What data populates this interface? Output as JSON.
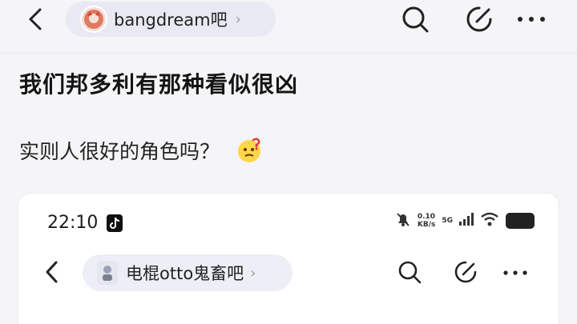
{
  "header": {
    "forum_name": "bangdream吧",
    "chevron": "›",
    "icons": [
      "back-icon",
      "search-icon",
      "edit-icon",
      "more-icon"
    ]
  },
  "post": {
    "title": "我们邦多利有那种看似很凶",
    "body": "实则人很好的角色吗？",
    "emoji": "thinking-face-icon"
  },
  "screenshot": {
    "time": "22:10",
    "net_speed_value": "0.10",
    "net_speed_unit": "KB/s",
    "network": "5G",
    "forum_name": "电棍otto鬼畜吧",
    "chevron": "›"
  },
  "colors": {
    "background": "#f5f5f7",
    "chip": "#e9e9f4",
    "card": "#ffffff",
    "text": "#1a1a1a"
  }
}
